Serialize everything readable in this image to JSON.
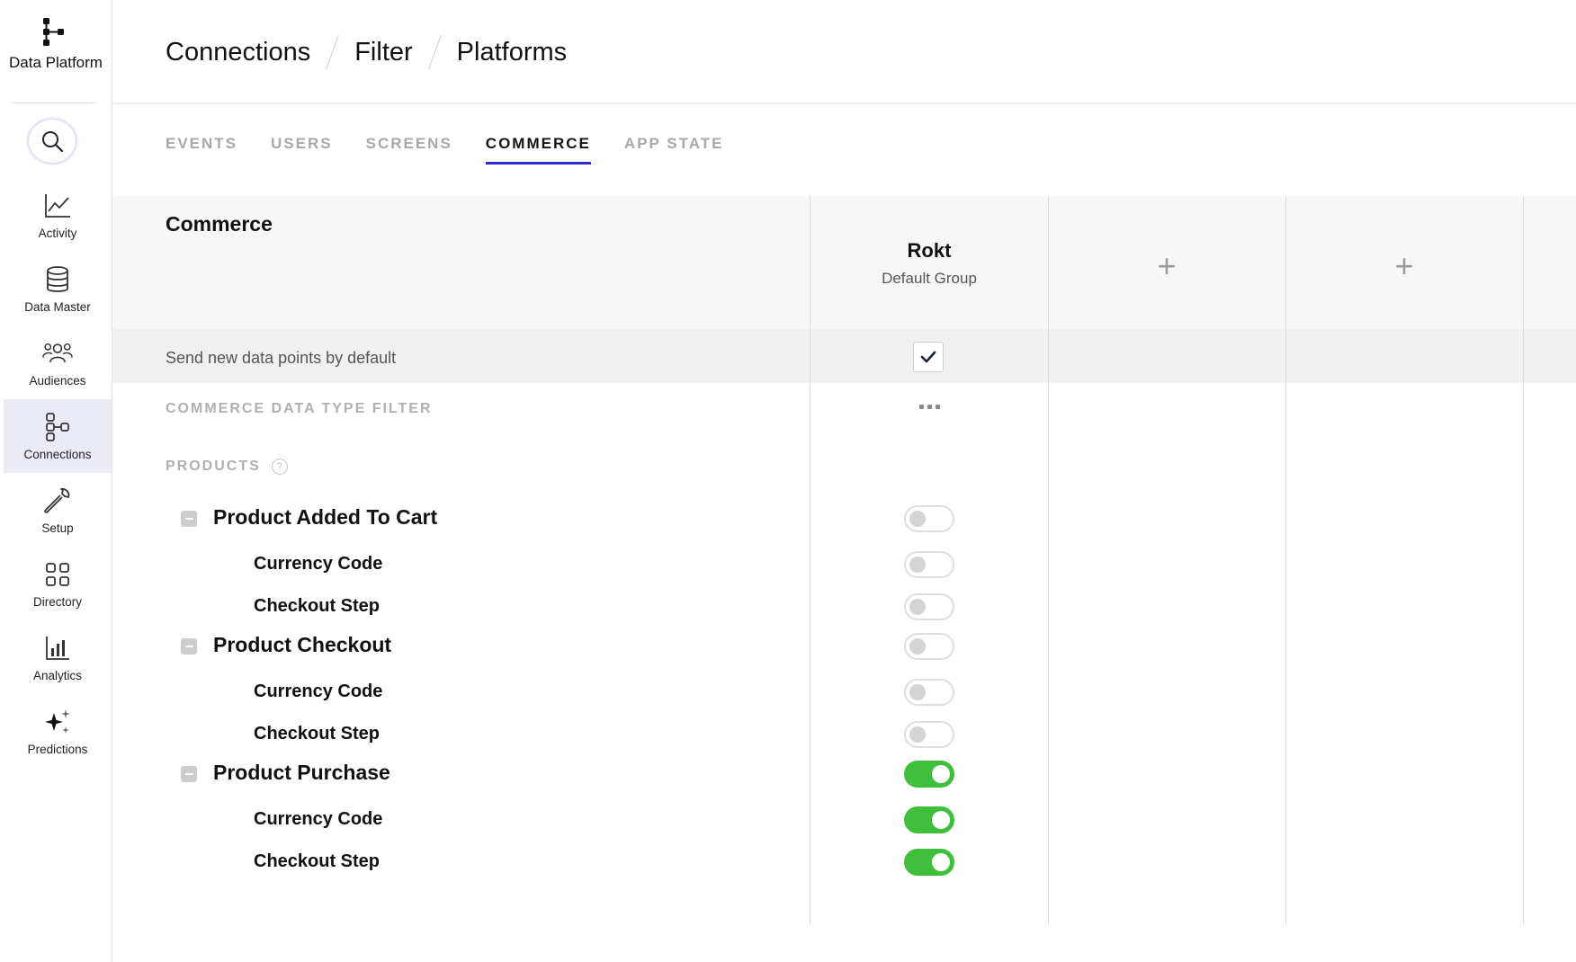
{
  "app": {
    "name": "Data Platform"
  },
  "sidebar": {
    "items": [
      {
        "label": "Activity",
        "icon": "activity-chart-icon",
        "active": false
      },
      {
        "label": "Data Master",
        "icon": "database-icon",
        "active": false
      },
      {
        "label": "Audiences",
        "icon": "audiences-icon",
        "active": false
      },
      {
        "label": "Connections",
        "icon": "connections-icon",
        "active": true
      },
      {
        "label": "Setup",
        "icon": "wrench-icon",
        "active": false
      },
      {
        "label": "Directory",
        "icon": "grid-icon",
        "active": false
      },
      {
        "label": "Analytics",
        "icon": "bar-chart-icon",
        "active": false
      },
      {
        "label": "Predictions",
        "icon": "sparkle-icon",
        "active": false
      }
    ]
  },
  "breadcrumb": [
    "Connections",
    "Filter",
    "Platforms"
  ],
  "tabs": [
    {
      "label": "EVENTS",
      "active": false
    },
    {
      "label": "USERS",
      "active": false
    },
    {
      "label": "SCREENS",
      "active": false
    },
    {
      "label": "COMMERCE",
      "active": true
    },
    {
      "label": "APP STATE",
      "active": false
    }
  ],
  "grid": {
    "section_title": "Commerce",
    "column": {
      "name": "Rokt",
      "group": "Default Group"
    },
    "add_column_symbol": "+",
    "default_label": "Send new data points by default",
    "default_checked": true,
    "filter_label": "COMMERCE DATA TYPE FILTER",
    "products_label": "PRODUCTS",
    "help_symbol": "?",
    "rows": [
      {
        "label": "Product Added To Cart",
        "level": "parent",
        "enabled": false
      },
      {
        "label": "Currency Code",
        "level": "child",
        "enabled": false
      },
      {
        "label": "Checkout Step",
        "level": "child",
        "enabled": false
      },
      {
        "label": "Product Checkout",
        "level": "parent",
        "enabled": false
      },
      {
        "label": "Currency Code",
        "level": "child",
        "enabled": false
      },
      {
        "label": "Checkout Step",
        "level": "child",
        "enabled": false
      },
      {
        "label": "Product Purchase",
        "level": "parent",
        "enabled": true
      },
      {
        "label": "Currency Code",
        "level": "child",
        "enabled": true
      },
      {
        "label": "Checkout Step",
        "level": "child",
        "enabled": true
      }
    ]
  },
  "colors": {
    "accent": "#2d2cc8",
    "toggle_on": "#3fbf3b",
    "active_nav_bg": "#ebebf6"
  }
}
